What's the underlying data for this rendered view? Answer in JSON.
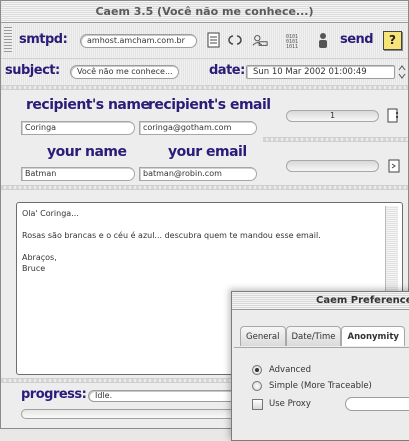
{
  "window": {
    "title": "Caem 3.5 (Você não me conhece...)"
  },
  "header": {
    "smtpd_label": "smtpd:",
    "smtpd_value": "amhost.amcham.com.br",
    "send_label": "send",
    "help_label": "?"
  },
  "subject": {
    "label": "subject:",
    "value": "Você não me conhece...",
    "date_label": "date:",
    "date_value": "Sun  10 Mar 2002 01:00:49"
  },
  "recipient": {
    "name_label": "recipient's name",
    "email_label": "recipient's email",
    "name_value": "Coringa",
    "email_value": "coringa@gotham.com",
    "count": "1"
  },
  "sender": {
    "name_label": "your name",
    "email_label": "your email",
    "name_value": "Batman",
    "email_value": "batman@robin.com"
  },
  "message": {
    "lines": [
      "Ola' Coringa...",
      "",
      "Rosas são brancas e o céu é azul... descubra quem te mandou esse email.",
      "",
      "Abraços,",
      "Bruce"
    ]
  },
  "progress": {
    "label": "progress:",
    "status": "Idle."
  },
  "prefs": {
    "title": "Caem Preferences",
    "tabs": [
      "General",
      "Date/Time",
      "Anonymity"
    ],
    "active_tab": "Anonymity",
    "options": {
      "advanced": "Advanced",
      "simple": "Simple (More Traceable)",
      "use_proxy": "Use Proxy"
    }
  },
  "colors": {
    "label": "#2a1c78",
    "field_border": "#9c9c9c"
  }
}
